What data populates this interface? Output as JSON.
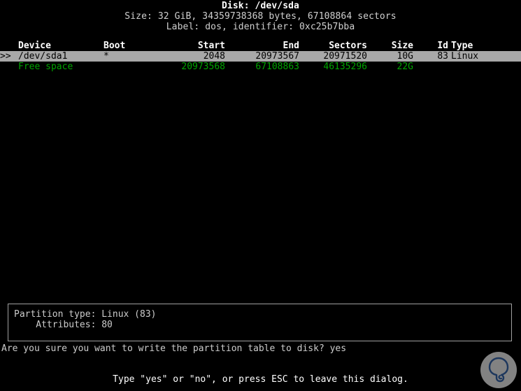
{
  "screen": {
    "background": "#000000",
    "foreground": "#c8c8c8",
    "highlight_bg": "#a8a8a8",
    "free_space_color": "#00a400"
  },
  "disk_header": {
    "title": "Disk: /dev/sda",
    "size_line": "Size: 32 GiB, 34359738368 bytes, 67108864 sectors",
    "label_line": "Label: dos, identifier: 0xc25b7bba"
  },
  "table": {
    "columns": [
      "Device",
      "Boot",
      "Start",
      "End",
      "Sectors",
      "Size",
      "Id",
      "Type"
    ],
    "rows": [
      {
        "marker": ">>",
        "device": "/dev/sda1",
        "boot": "*",
        "start": "2048",
        "end": "20973567",
        "sectors": "20971520",
        "size": "10G",
        "id": "83",
        "type": "Linux",
        "selected": true,
        "free": false
      },
      {
        "marker": "",
        "device": "Free space",
        "boot": "",
        "start": "20973568",
        "end": "67108863",
        "sectors": "46135296",
        "size": "22G",
        "id": "",
        "type": "",
        "selected": false,
        "free": true
      }
    ]
  },
  "info_box": {
    "partition_type": "Partition type: Linux (83)",
    "attributes": "    Attributes: 80"
  },
  "prompt": {
    "question": "Are you sure you want to write the partition table to disk? yes",
    "hint": "Type \"yes\" or \"no\", or press ESC to leave this dialog."
  },
  "watermark": {
    "name": "q-logo-watermark",
    "circle_color": "#8a8a8a",
    "glyph_color": "#1f3a63"
  }
}
